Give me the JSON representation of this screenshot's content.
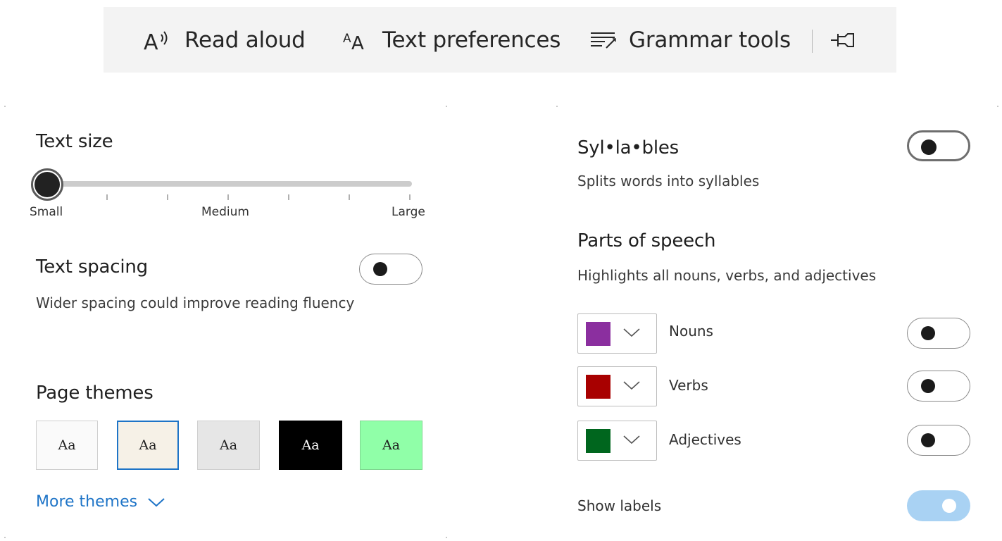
{
  "toolbar": {
    "read_aloud": "Read aloud",
    "text_preferences": "Text preferences",
    "grammar_tools": "Grammar tools",
    "icons": [
      "read-aloud-icon",
      "text-preferences-icon",
      "grammar-tools-icon",
      "pin-icon"
    ]
  },
  "text_size": {
    "title": "Text size",
    "labels": {
      "small": "Small",
      "medium": "Medium",
      "large": "Large"
    },
    "value": "Small"
  },
  "text_spacing": {
    "title": "Text spacing",
    "description": "Wider spacing could improve reading fluency",
    "enabled": false
  },
  "page_themes": {
    "title": "Page themes",
    "sample": "Aa",
    "themes": [
      {
        "bg": "#fafafa",
        "fg": "#1f1f1f",
        "selected": false
      },
      {
        "bg": "#f6f1e7",
        "fg": "#1f1f1f",
        "selected": true
      },
      {
        "bg": "#e6e6e6",
        "fg": "#1f1f1f",
        "selected": false
      },
      {
        "bg": "#000000",
        "fg": "#ffffff",
        "selected": false
      },
      {
        "bg": "#90ffa8",
        "fg": "#1f1f1f",
        "selected": false
      }
    ],
    "more_label": "More themes"
  },
  "syllables": {
    "title": "Syl•la•bles",
    "description": "Splits words into syllables",
    "enabled": false
  },
  "parts_of_speech": {
    "title": "Parts of speech",
    "description": "Highlights all nouns, verbs, and adjectives",
    "items": [
      {
        "label": "Nouns",
        "color": "#8b2f9f",
        "enabled": false
      },
      {
        "label": "Verbs",
        "color": "#a80000",
        "enabled": false
      },
      {
        "label": "Adjectives",
        "color": "#00661e",
        "enabled": false
      }
    ],
    "show_labels": {
      "label": "Show labels",
      "enabled": true
    }
  },
  "colors": {
    "accent": "#1e74c7",
    "toolbar_bg": "#f3f3f3",
    "toggle_on": "#a9d2f3"
  }
}
